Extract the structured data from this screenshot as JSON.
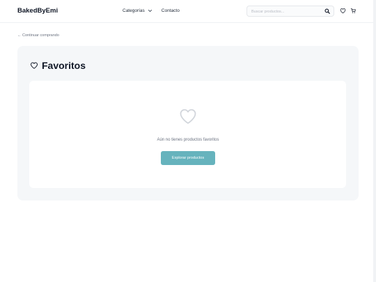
{
  "header": {
    "brand": "BakedByEmi",
    "nav": [
      {
        "label": "Categorías"
      },
      {
        "label": "Contacto"
      }
    ],
    "search_placeholder": "Buscar productos..."
  },
  "back_link": "← Continuar comprando",
  "page_title": "Favoritos",
  "empty_state": {
    "message": "Aún no tienes productos favoritos",
    "button_label": "Explorar productos"
  },
  "colors": {
    "accent": "#66b3bd",
    "panel": "#f5f7f9"
  }
}
